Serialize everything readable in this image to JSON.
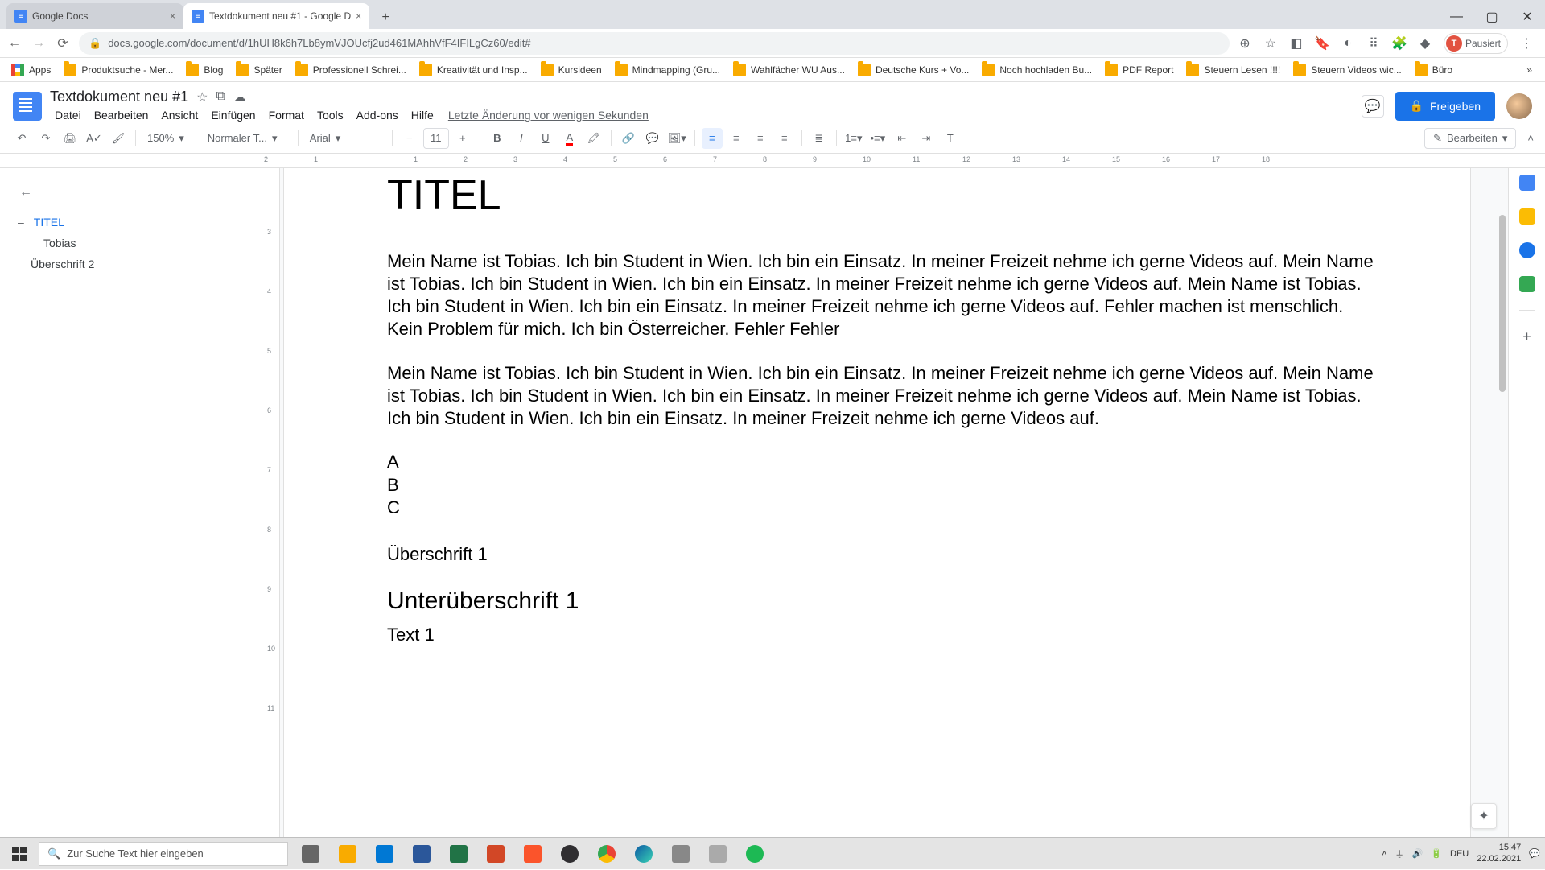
{
  "tabs": [
    {
      "title": "Google Docs"
    },
    {
      "title": "Textdokument neu #1 - Google D"
    }
  ],
  "url": "docs.google.com/document/d/1hUH8k6h7Lb8ymVJOUcfj2ud461MAhhVfF4IFILgCz60/edit#",
  "profile_pause": "Pausiert",
  "profile_letter": "T",
  "bookmarks": [
    "Apps",
    "Produktsuche - Mer...",
    "Blog",
    "Später",
    "Professionell Schrei...",
    "Kreativität und Insp...",
    "Kursideen",
    "Mindmapping (Gru...",
    "Wahlfächer WU Aus...",
    "Deutsche Kurs + Vo...",
    "Noch hochladen Bu...",
    "PDF Report",
    "Steuern Lesen !!!!",
    "Steuern Videos wic...",
    "Büro"
  ],
  "doc_title": "Textdokument neu #1",
  "menu": [
    "Datei",
    "Bearbeiten",
    "Ansicht",
    "Einfügen",
    "Format",
    "Tools",
    "Add-ons",
    "Hilfe"
  ],
  "last_change": "Letzte Änderung vor wenigen Sekunden",
  "share_label": "Freigeben",
  "zoom": "150%",
  "style_select": "Normaler T...",
  "font_select": "Arial",
  "font_size": "11",
  "edit_mode": "Bearbeiten",
  "outline": [
    {
      "label": "TITEL",
      "level": "l1",
      "active": true,
      "dash": "–"
    },
    {
      "label": "Tobias",
      "level": "l2",
      "active": false
    },
    {
      "label": "Überschrift 2",
      "level": "l1b",
      "active": false
    }
  ],
  "ruler_ticks": [
    "2",
    "1",
    "",
    "1",
    "2",
    "3",
    "4",
    "5",
    "6",
    "7",
    "8",
    "9",
    "10",
    "11",
    "12",
    "13",
    "14",
    "15",
    "16",
    "17",
    "18"
  ],
  "vruler": [
    "",
    "3",
    "4",
    "5",
    "6",
    "7",
    "8",
    "9",
    "10",
    "11"
  ],
  "content": {
    "title": "TITEL",
    "para1": "Mein Name ist Tobias. Ich bin Student in Wien. Ich bin ein Einsatz. In meiner Freizeit nehme ich gerne Videos auf. Mein Name ist Tobias. Ich bin Student in Wien. Ich bin ein Einsatz. In meiner Freizeit nehme ich gerne Videos auf. Mein Name ist Tobias. Ich bin Student in Wien. Ich bin ein Einsatz. In meiner Freizeit nehme ich gerne Videos auf. Fehler machen ist menschlich. Kein Problem für mich. Ich bin Österreicher. Fehler Fehler",
    "para2": "Mein Name ist Tobias. Ich bin Student in Wien. Ich bin ein Einsatz. In meiner Freizeit nehme ich gerne Videos auf. Mein Name ist Tobias. Ich bin Student in Wien. Ich bin ein Einsatz. In meiner Freizeit nehme ich gerne Videos auf. Mein Name ist Tobias. Ich bin Student in Wien. Ich bin ein Einsatz. In meiner Freizeit nehme ich gerne Videos auf.",
    "listA": "A",
    "listB": "B",
    "listC": "C",
    "h2": "Überschrift 1",
    "h3": "Unterüberschrift 1",
    "txt1": "Text 1"
  },
  "search_placeholder": "Zur Suche Text hier eingeben",
  "tray": {
    "lang": "DEU",
    "time": "15:47",
    "date": "22.02.2021"
  }
}
